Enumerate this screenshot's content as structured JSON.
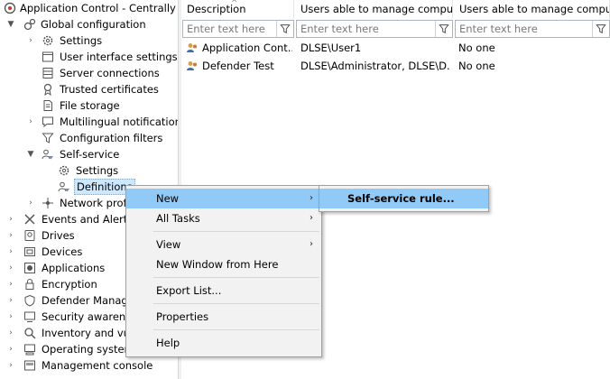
{
  "tree": {
    "root": "Application Control - Centrally s",
    "global": "Global configuration",
    "settings": "Settings",
    "ui_settings": "User interface settings",
    "server_connections": "Server connections",
    "trusted_certificates": "Trusted certificates",
    "file_storage": "File storage",
    "multilingual": "Multilingual notification",
    "config_filters": "Configuration filters",
    "self_service": "Self-service",
    "ss_settings": "Settings",
    "definitions": "Definitions",
    "network_profiles": "Network profi",
    "events": "Events and Alerts",
    "drives": "Drives",
    "devices": "Devices",
    "applications": "Applications",
    "encryption": "Encryption",
    "defender": "Defender Manage",
    "security_awareness": "Security awarenes",
    "inventory": "Inventory and vul",
    "operating_system": "Operating system",
    "management_console": "Management console"
  },
  "list": {
    "columns": [
      "Description",
      "Users able to manage compu...",
      "Users able to manage compu..."
    ],
    "filter_placeholder": "Enter text here",
    "rows": [
      {
        "description": "Application Cont...",
        "users1": "DLSE\\User1",
        "users2": "No one"
      },
      {
        "description": "Defender Test",
        "users1": "DLSE\\Administrator, DLSE\\D...",
        "users2": "No one"
      }
    ]
  },
  "context_menu": {
    "new": "New",
    "all_tasks": "All Tasks",
    "view": "View",
    "new_window": "New Window from Here",
    "export_list": "Export List...",
    "properties": "Properties",
    "help": "Help"
  },
  "submenu": {
    "self_service_rule": "Self-service rule..."
  }
}
